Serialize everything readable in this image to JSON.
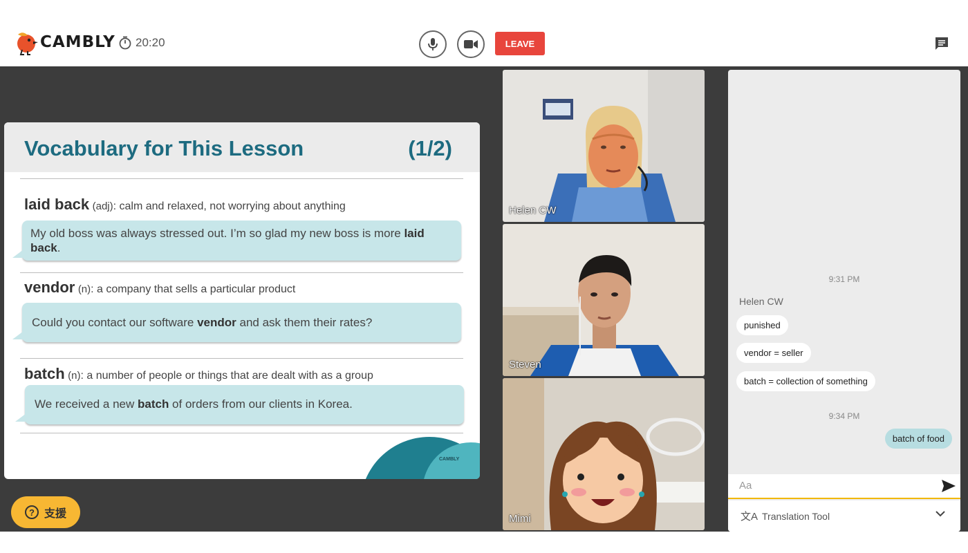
{
  "brand": {
    "name": "CAMBLY"
  },
  "timer": {
    "value": "20:20"
  },
  "controls": {
    "leave_label": "LEAVE"
  },
  "slide": {
    "title": "Vocabulary for This Lesson",
    "page": "(1/2)",
    "brand_mark": "CAMBLY",
    "entries": [
      {
        "word": "laid back",
        "pos": "(adj)",
        "definition": ": calm and relaxed, not worrying about anything",
        "example_before": "My old boss was always stressed out. I’m so glad my new boss is more ",
        "example_bold": "laid back",
        "example_after": "."
      },
      {
        "word": "vendor",
        "pos": "(n)",
        "definition": ": a company that sells a particular product",
        "example_before": "Could you contact our software ",
        "example_bold": "vendor",
        "example_after": " and ask them their rates?"
      },
      {
        "word": "batch",
        "pos": "(n)",
        "definition": ": a number of people or things that are dealt with as a group",
        "example_before": "We received a new ",
        "example_bold": "batch",
        "example_after": " of orders from our clients in Korea."
      }
    ]
  },
  "support": {
    "label": "支援"
  },
  "participants": [
    {
      "name": "Helen CW"
    },
    {
      "name": "Steven"
    },
    {
      "name": "Mimi"
    }
  ],
  "chat": {
    "timestamp1": "9:31 PM",
    "sender": "Helen CW",
    "messages": [
      "punished",
      "vendor = seller",
      "batch = collection of something"
    ],
    "timestamp2": "9:34 PM",
    "my_message": "batch of food",
    "input_placeholder": "Aa",
    "translation_label": "Translation Tool"
  },
  "colors": {
    "accent_teal": "#1d6b80",
    "leave_red": "#e8453c",
    "support_yellow": "#f7b733",
    "bubble_teal": "#c7e6e9"
  },
  "icons": [
    "cambly-bird-logo",
    "stopwatch-icon",
    "microphone-icon",
    "camera-icon",
    "chat-icon",
    "help-icon",
    "send-icon",
    "translate-icon",
    "chevron-down-icon"
  ]
}
